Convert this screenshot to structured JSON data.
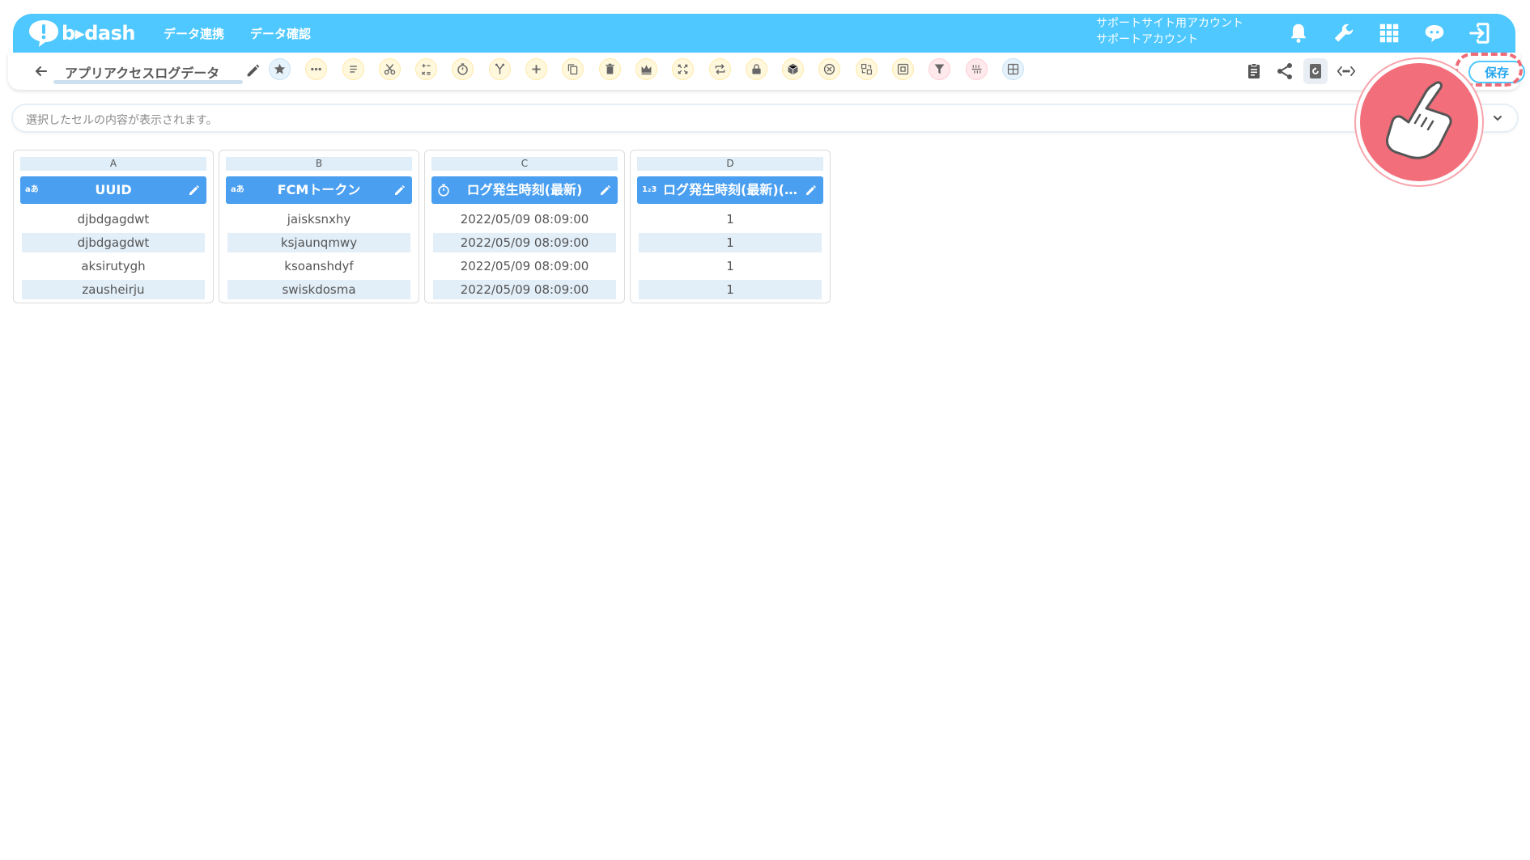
{
  "app": {
    "logo_text": "b▸dash",
    "nav": [
      "データ連携",
      "データ確認"
    ],
    "account_line1": "サポートサイト用アカウント",
    "account_line2": "サポートアカウント"
  },
  "header_icons": [
    "bell-icon",
    "wrench-icon",
    "grid-icon",
    "chat-bot-icon",
    "logout-icon"
  ],
  "toolbar": {
    "title": "アプリアクセスログデータ",
    "save_label": "保存",
    "tools": [
      {
        "name": "favorite-star-icon",
        "tint": "blue"
      },
      {
        "name": "more-dots-icon",
        "tint": "yellow"
      },
      {
        "name": "text-lines-icon",
        "tint": "yellow"
      },
      {
        "name": "scissors-icon",
        "tint": "yellow"
      },
      {
        "name": "calculate-icon",
        "tint": "yellow"
      },
      {
        "name": "timer-icon",
        "tint": "yellow"
      },
      {
        "name": "merge-icon",
        "tint": "yellow"
      },
      {
        "name": "add-icon",
        "tint": "yellow"
      },
      {
        "name": "copy-icon",
        "tint": "yellow"
      },
      {
        "name": "trash-icon",
        "tint": "yellow"
      },
      {
        "name": "crown-icon",
        "tint": "yellow"
      },
      {
        "name": "expand-icon",
        "tint": "yellow"
      },
      {
        "name": "repeat-icon",
        "tint": "yellow"
      },
      {
        "name": "lock-icon",
        "tint": "yellow"
      },
      {
        "name": "box-icon",
        "tint": "yellow"
      },
      {
        "name": "cancel-circle-icon",
        "tint": "yellow"
      },
      {
        "name": "replace-icon",
        "tint": "yellow"
      },
      {
        "name": "frame-icon",
        "tint": "yellow"
      },
      {
        "name": "filter-icon",
        "tint": "pink"
      },
      {
        "name": "pattern-icon",
        "tint": "pink"
      },
      {
        "name": "table-grid-icon",
        "tint": "blue"
      }
    ],
    "right_tools": [
      "clipboard-icon",
      "share-icon",
      "refresh-icon",
      "code-icon"
    ]
  },
  "cell_bar": {
    "placeholder": "選択したセルの内容が表示されます。"
  },
  "columns": [
    {
      "letter": "A",
      "type_label": "aあ",
      "type_icon": "text-type-icon",
      "name": "UUID",
      "cells": [
        "djbdgagdwt",
        "djbdgagdwt",
        "aksirutygh",
        "zausheirju"
      ]
    },
    {
      "letter": "B",
      "type_label": "aあ",
      "type_icon": "text-type-icon",
      "name": "FCMトークン",
      "cells": [
        "jaisksnxhy",
        "ksjaunqmwy",
        "ksoanshdyf",
        "swiskdosma"
      ]
    },
    {
      "letter": "C",
      "type_label": "",
      "type_icon": "timer-type-icon",
      "name": "ログ発生時刻(最新)",
      "cells": [
        "2022/05/09 08:09:00",
        "2022/05/09 08:09:00",
        "2022/05/09 08:09:00",
        "2022/05/09 08:09:00"
      ]
    },
    {
      "letter": "D",
      "type_label": "1₂3",
      "type_icon": "number-type-icon",
      "name": "ログ発生時刻(最新)(…",
      "cells": [
        "1",
        "1",
        "1",
        "1"
      ]
    }
  ],
  "colors": {
    "header": "#4ec8ff",
    "column_header": "#4a9ff0",
    "alt_row": "#e2eef8",
    "highlight": "#f26e7a"
  }
}
